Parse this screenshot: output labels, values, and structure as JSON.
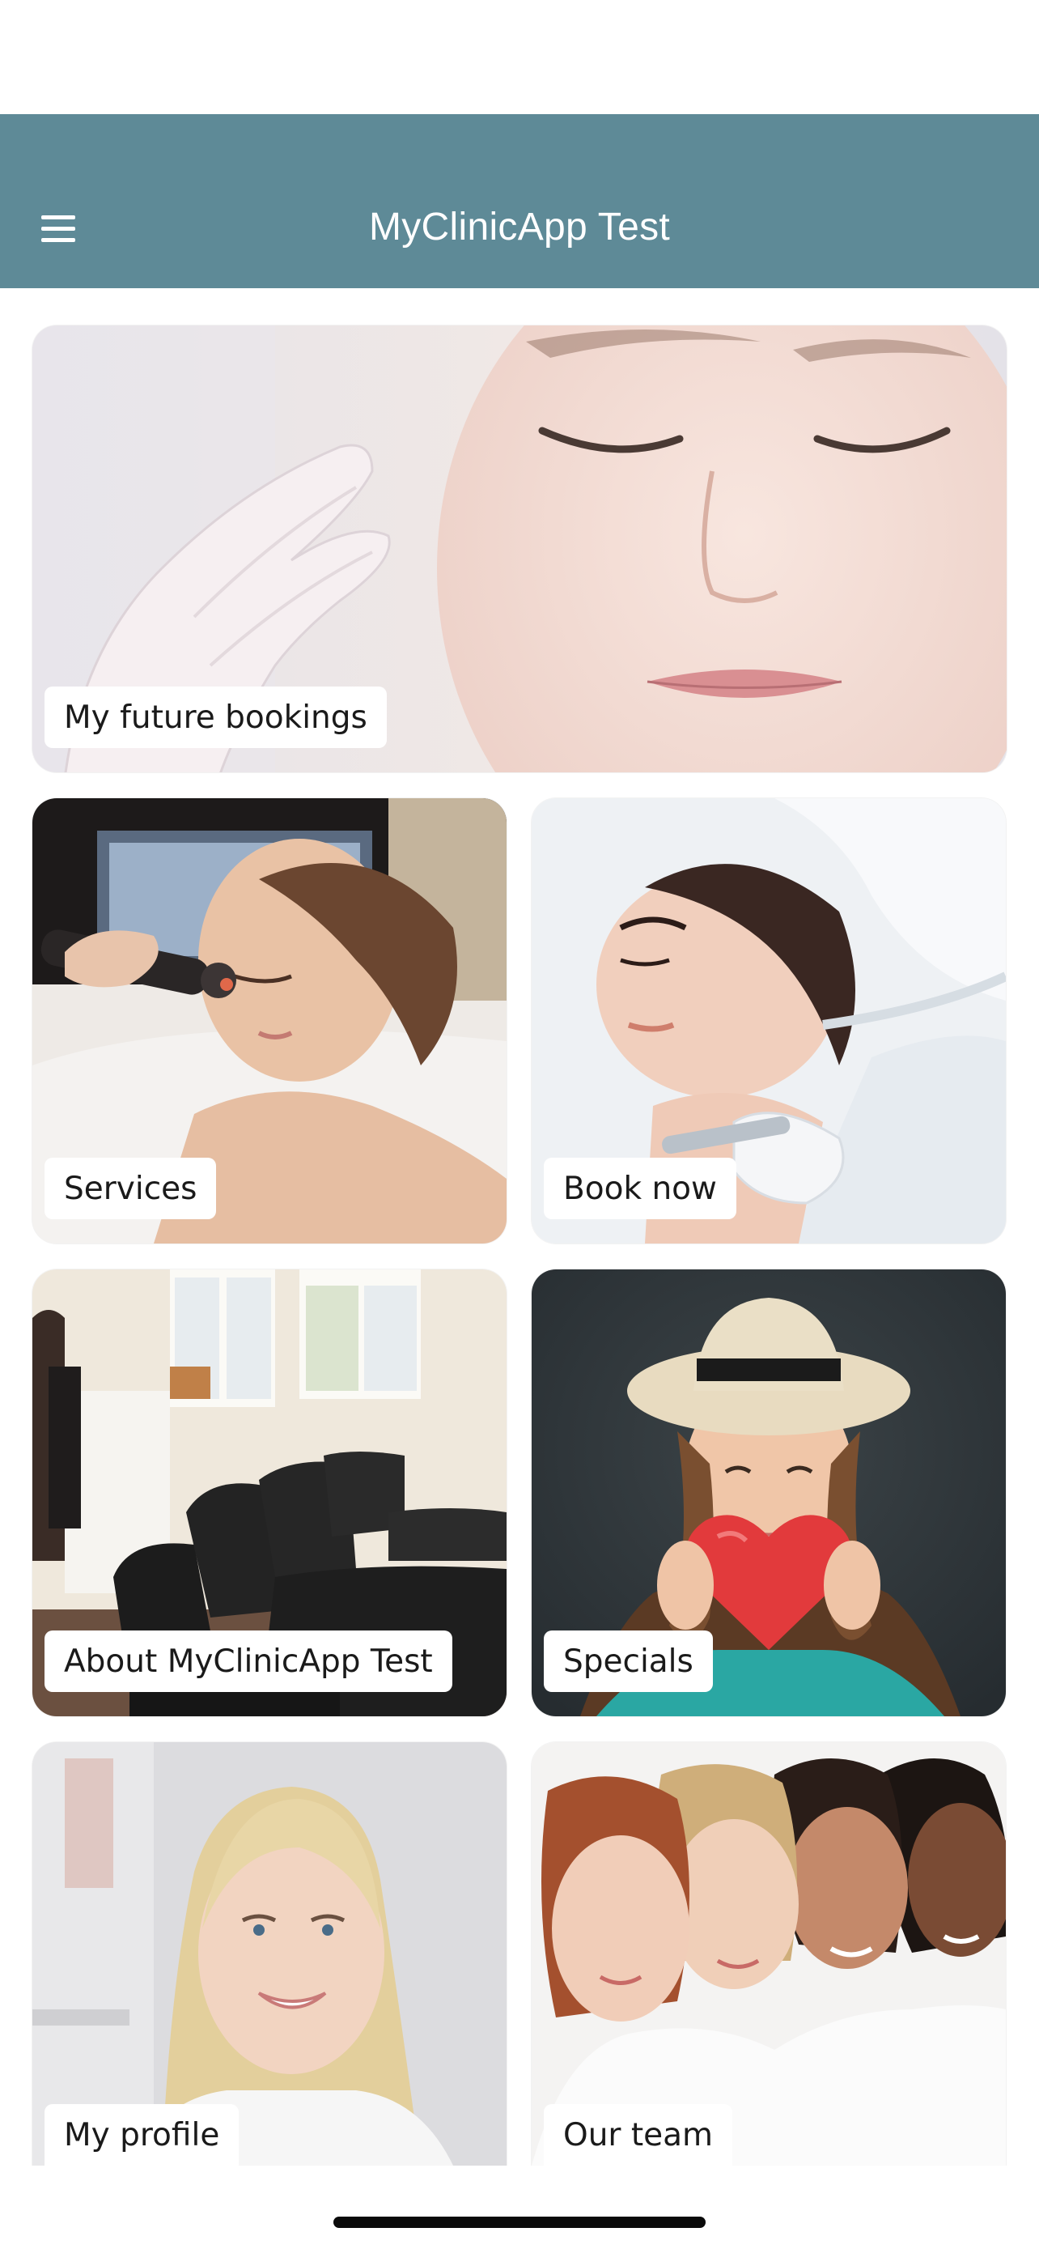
{
  "header": {
    "title": "MyClinicApp Test",
    "menu_icon": "hamburger-menu-icon",
    "background_color": "#5e8a97"
  },
  "tiles": [
    {
      "label": "My future bookings",
      "image": "photo-woman-facial-treatment"
    },
    {
      "label": "Services",
      "image": "photo-laser-skin-treatment"
    },
    {
      "label": "Book now",
      "image": "photo-microdermabrasion"
    },
    {
      "label": "About MyClinicApp Test",
      "image": "photo-salon-interior"
    },
    {
      "label": "Specials",
      "image": "photo-woman-with-heart"
    },
    {
      "label": "My profile",
      "image": "photo-smiling-blonde-woman"
    },
    {
      "label": "Our team",
      "image": "photo-team-of-women"
    }
  ]
}
